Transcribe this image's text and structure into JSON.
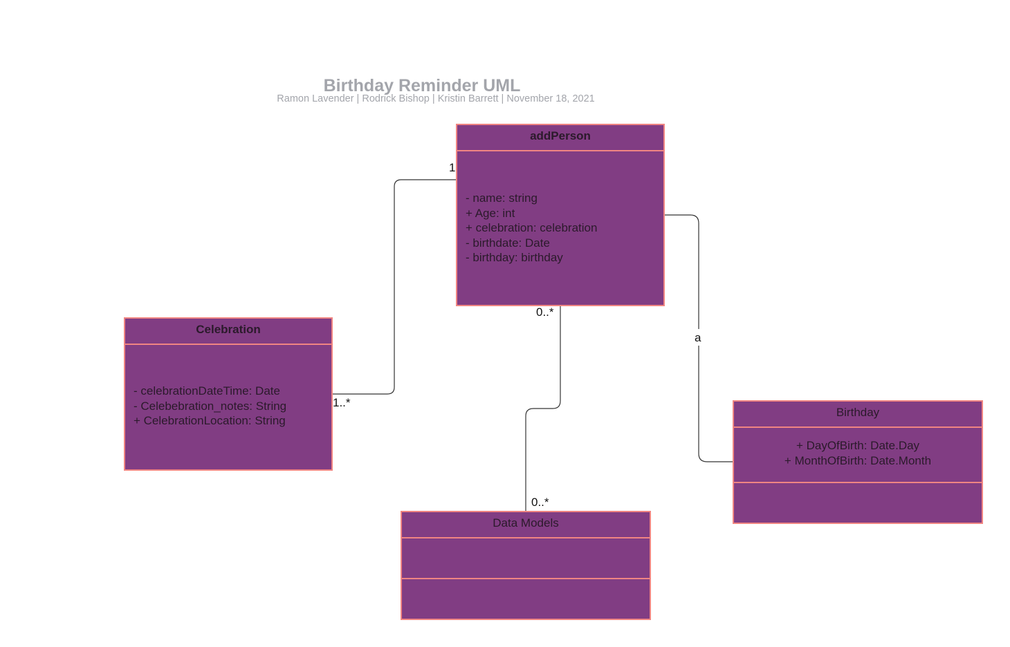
{
  "diagram": {
    "title": "Birthday Reminder UML",
    "subtitle": "Ramon Lavender | Rodrick Bishop | Kristin Barrett |  November 18, 2021"
  },
  "classes": {
    "addPerson": {
      "name": "addPerson",
      "attributes": [
        "- name: string",
        "+ Age: int",
        "+ celebration: celebration",
        "- birthdate: Date",
        "- birthday: birthday"
      ]
    },
    "celebration": {
      "name": "Celebration",
      "attributes": [
        "- celebrationDateTime: Date",
        "- Celebebration_notes: String",
        "+ CelebrationLocation: String"
      ]
    },
    "birthday": {
      "name": "Birthday",
      "attributes": [
        "+ DayOfBirth: Date.Day",
        "+ MonthOfBirth: Date.Month"
      ]
    },
    "dataModels": {
      "name": "Data Models"
    }
  },
  "associations": {
    "person_celebration": {
      "source_mult": "1",
      "target_mult": "1..*"
    },
    "person_datamodels": {
      "source_mult": "0..*",
      "target_mult": "0..*"
    },
    "person_birthday": {
      "label": "a"
    }
  },
  "colors": {
    "class_fill": "#813d83",
    "class_border": "#f08582",
    "title": "#a3a5ab",
    "connector": "#333333"
  }
}
